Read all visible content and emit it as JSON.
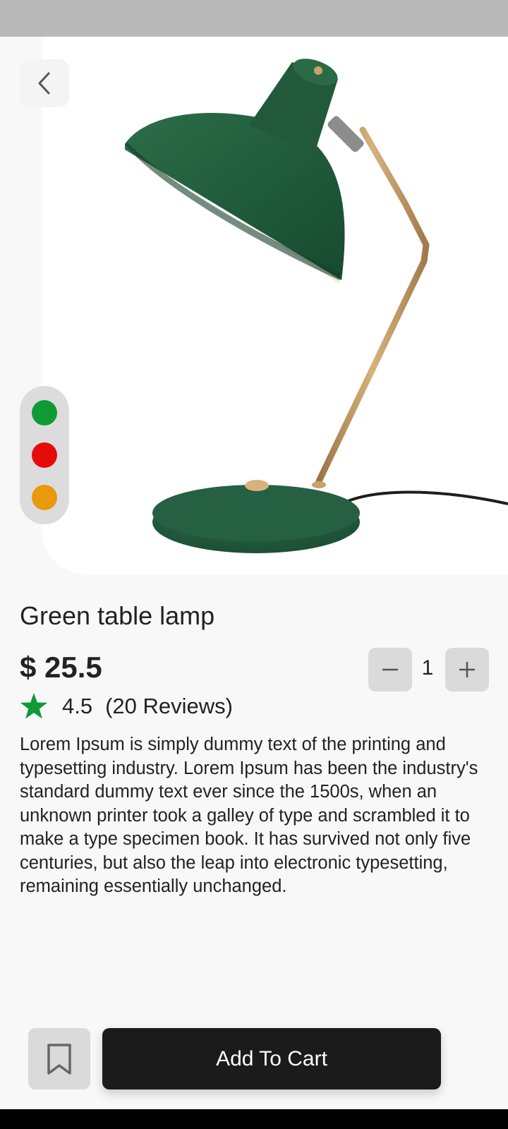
{
  "product": {
    "title": "Green table lamp",
    "price": "$ 25.5",
    "rating": "4.5",
    "reviews": "(20 Reviews)",
    "description": "Lorem Ipsum is simply dummy text of the printing and typesetting industry. Lorem Ipsum has been the industry's standard dummy text ever since the 1500s, when an unknown printer took a galley of type and scrambled it to make a type specimen book. It has survived not only five centuries, but also the leap into electronic typesetting, remaining essentially unchanged."
  },
  "quantity": {
    "value": "1"
  },
  "colors": {
    "options": [
      "#0f9a36",
      "#e60b0b",
      "#e89a0c"
    ],
    "star": "#0f9a36",
    "lamp_body": "#21593b",
    "lamp_stem": "#c39a62"
  },
  "icons": {
    "back": "chevron-left-icon",
    "decrement": "minus-icon",
    "increment": "plus-icon",
    "star": "star-icon",
    "bookmark": "bookmark-icon"
  },
  "actions": {
    "add_to_cart": "Add To Cart"
  }
}
